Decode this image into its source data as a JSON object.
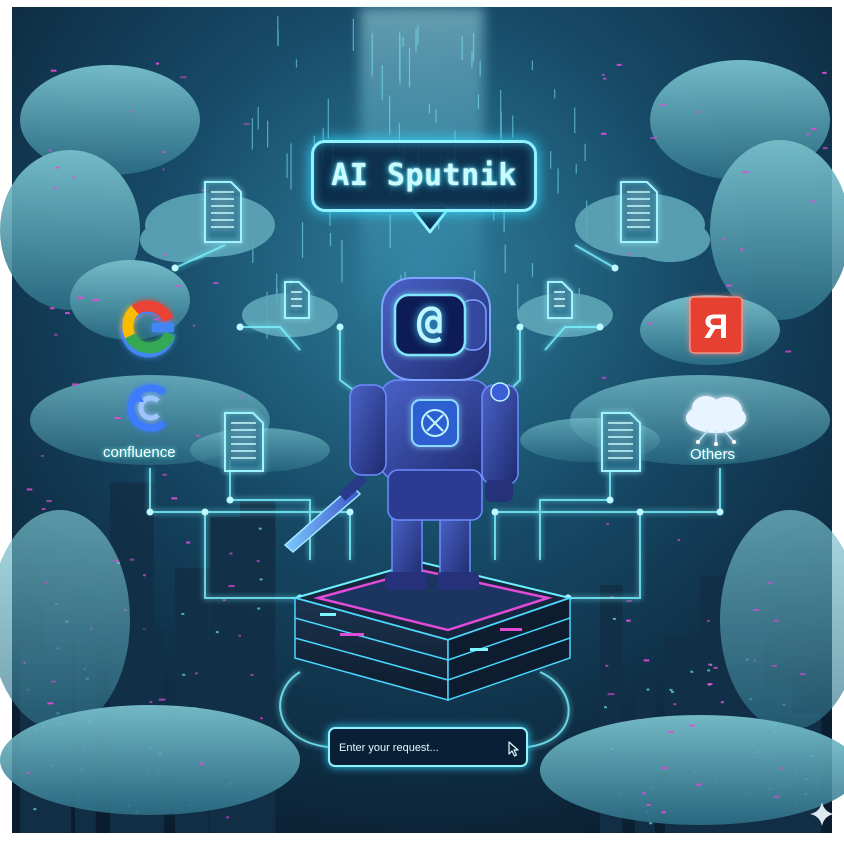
{
  "banner": {
    "title": "AI Sputnik"
  },
  "sources": {
    "google": {
      "icon": "google-logo-icon"
    },
    "confluence": {
      "label": "confluence",
      "icon": "confluence-logo-icon"
    },
    "yandex": {
      "letter": "Я",
      "icon": "yandex-logo-icon"
    },
    "others": {
      "label": "Others",
      "icon": "cloud-network-icon"
    }
  },
  "request_box": {
    "placeholder": "Enter your request..."
  },
  "robot": {
    "emblem": "@"
  },
  "colors": {
    "background": "#0d2a3f",
    "glow": "#52e6ff",
    "accent_magenta": "#e04cd6",
    "yandex_red": "#e63f32"
  }
}
